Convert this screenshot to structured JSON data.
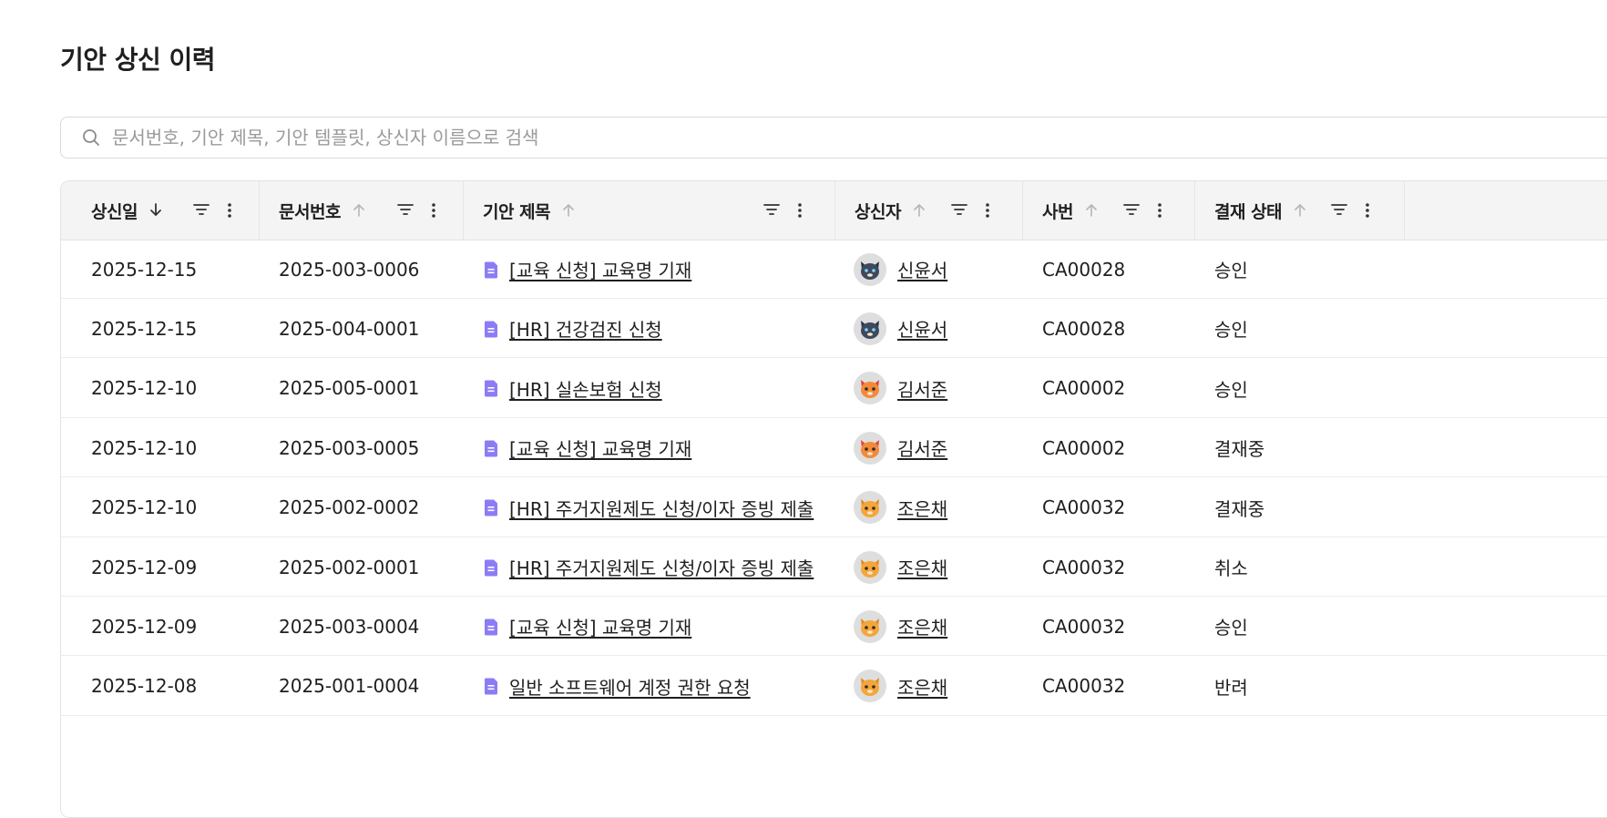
{
  "page": {
    "title": "기안 상신 이력"
  },
  "search": {
    "placeholder": "문서번호, 기안 제목, 기안 템플릿, 상신자 이름으로 검색"
  },
  "columns": [
    {
      "label": "상신일",
      "sort": "desc"
    },
    {
      "label": "문서번호",
      "sort": "asc"
    },
    {
      "label": "기안 제목",
      "sort": "asc"
    },
    {
      "label": "상신자",
      "sort": "asc"
    },
    {
      "label": "사번",
      "sort": "asc"
    },
    {
      "label": "결재 상태",
      "sort": "asc"
    }
  ],
  "rows": [
    {
      "date": "2025-12-15",
      "doc_no": "2025-003-0006",
      "title": "[교육 신청] 교육명 기재",
      "submitter": "신윤서",
      "avatar": "dark-cat-avatar",
      "emp_no": "CA00028",
      "status": "승인"
    },
    {
      "date": "2025-12-15",
      "doc_no": "2025-004-0001",
      "title": "[HR] 건강검진 신청",
      "submitter": "신윤서",
      "avatar": "dark-cat-avatar",
      "emp_no": "CA00028",
      "status": "승인"
    },
    {
      "date": "2025-12-10",
      "doc_no": "2025-005-0001",
      "title": "[HR] 실손보험 신청",
      "submitter": "김서준",
      "avatar": "red-cat-avatar",
      "emp_no": "CA00002",
      "status": "승인"
    },
    {
      "date": "2025-12-10",
      "doc_no": "2025-003-0005",
      "title": "[교육 신청] 교육명 기재",
      "submitter": "김서준",
      "avatar": "red-cat-avatar",
      "emp_no": "CA00002",
      "status": "결재중"
    },
    {
      "date": "2025-12-10",
      "doc_no": "2025-002-0002",
      "title": "[HR] 주거지원제도 신청/이자 증빙 제출",
      "submitter": "조은채",
      "avatar": "orange-cat-avatar",
      "emp_no": "CA00032",
      "status": "결재중"
    },
    {
      "date": "2025-12-09",
      "doc_no": "2025-002-0001",
      "title": "[HR] 주거지원제도 신청/이자 증빙 제출",
      "submitter": "조은채",
      "avatar": "orange-cat-avatar",
      "emp_no": "CA00032",
      "status": "취소"
    },
    {
      "date": "2025-12-09",
      "doc_no": "2025-003-0004",
      "title": "[교육 신청] 교육명 기재",
      "submitter": "조은채",
      "avatar": "orange-cat-avatar",
      "emp_no": "CA00032",
      "status": "승인"
    },
    {
      "date": "2025-12-08",
      "doc_no": "2025-001-0004",
      "title": "일반 소프트웨어 계정 권한 요청",
      "submitter": "조은채",
      "avatar": "orange-cat-avatar",
      "emp_no": "CA00032",
      "status": "반려"
    }
  ],
  "icons": {
    "search": "search-icon",
    "filter": "filter-icon",
    "menu": "more-vertical-icon",
    "document": "document-icon",
    "sort_desc": "arrow-down-icon",
    "sort_asc": "arrow-up-icon"
  },
  "colors": {
    "doc_icon": "#8b7cf6",
    "header_bg": "#f4f4f5",
    "text": "#1f1f1f"
  }
}
